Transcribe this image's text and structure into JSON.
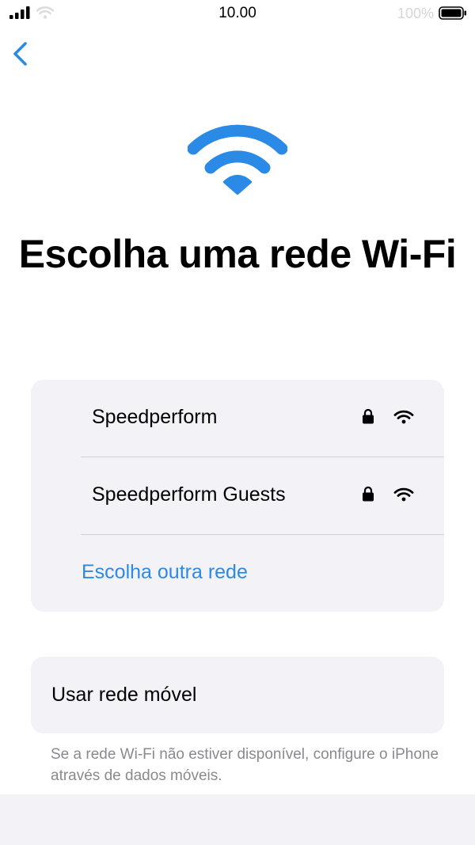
{
  "status_bar": {
    "time": "10.00",
    "battery_percent": "100%",
    "icons": [
      "signal-bars-icon",
      "wifi-status-icon",
      "battery-icon"
    ]
  },
  "nav": {
    "back_icon": "chevron-left-icon"
  },
  "hero": {
    "icon": "wifi-icon",
    "title": "Escolha uma rede Wi-Fi"
  },
  "networks": [
    {
      "name": "Speedperform",
      "secured": true,
      "icons": [
        "lock-icon",
        "wifi-signal-icon"
      ]
    },
    {
      "name": "Speedperform Guests",
      "secured": true,
      "icons": [
        "lock-icon",
        "wifi-signal-icon"
      ]
    }
  ],
  "other_network_label": "Escolha outra rede",
  "mobile": {
    "label": "Usar rede móvel",
    "footnote": "Se a rede Wi-Fi não estiver disponível, configure o iPhone através de dados móveis."
  },
  "colors": {
    "accent": "#2a8ae6",
    "card_background": "#f2f2f7",
    "secondary_text": "#8a8a8e"
  }
}
